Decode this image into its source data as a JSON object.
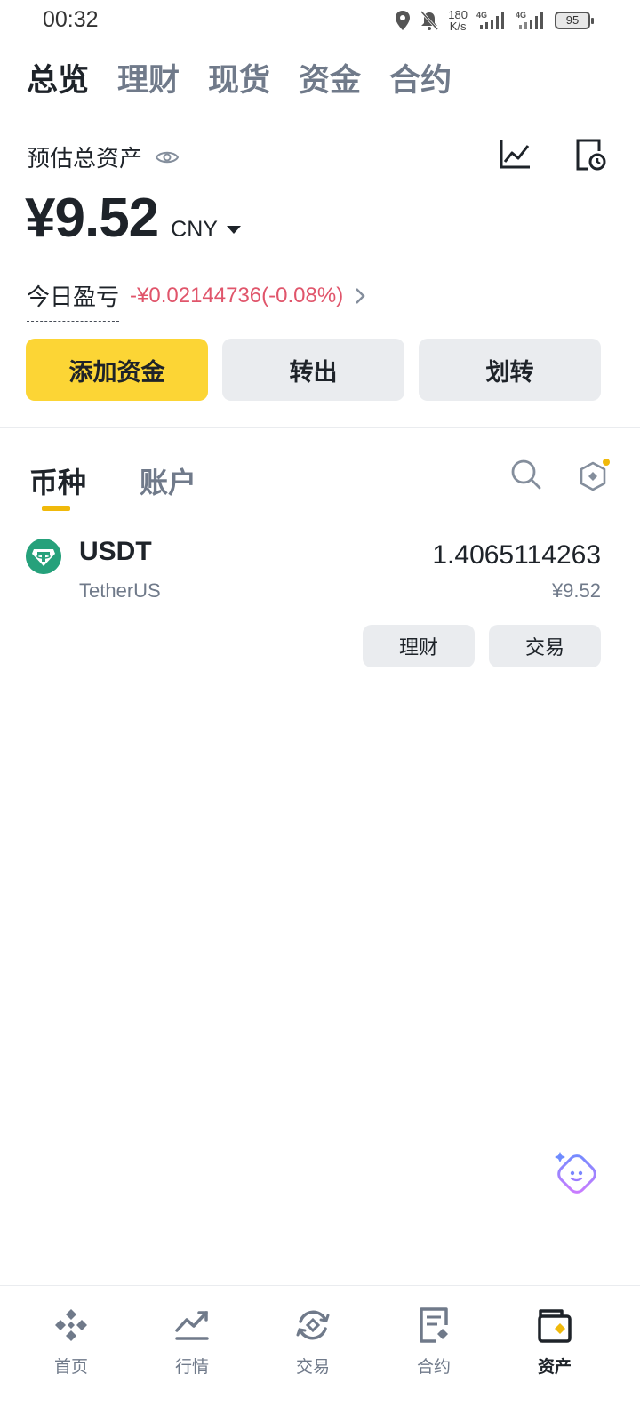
{
  "status_bar": {
    "time": "00:32",
    "speed_value": "180",
    "speed_unit": "K/s",
    "network_1": "4G",
    "network_2": "4G",
    "battery": "95"
  },
  "top_tabs": [
    {
      "label": "总览",
      "active": true
    },
    {
      "label": "理财",
      "active": false
    },
    {
      "label": "现货",
      "active": false
    },
    {
      "label": "资金",
      "active": false
    },
    {
      "label": "合约",
      "active": false
    }
  ],
  "overview": {
    "estimated_label": "预估总资产",
    "balance": "¥9.52",
    "currency": "CNY",
    "pnl_label": "今日盈亏",
    "pnl_value": "-¥0.02144736(-0.08%)"
  },
  "actions": {
    "deposit": "添加资金",
    "withdraw": "转出",
    "transfer": "划转"
  },
  "asset_tabs": [
    {
      "label": "币种",
      "active": true
    },
    {
      "label": "账户",
      "active": false
    }
  ],
  "assets": [
    {
      "symbol": "USDT",
      "name": "TetherUS",
      "amount": "1.4065114263",
      "value": "¥9.52",
      "buttons": {
        "earn": "理财",
        "trade": "交易"
      }
    }
  ],
  "bottom_nav": [
    {
      "label": "首页",
      "icon": "home-icon",
      "active": false
    },
    {
      "label": "行情",
      "icon": "markets-icon",
      "active": false
    },
    {
      "label": "交易",
      "icon": "trade-icon",
      "active": false
    },
    {
      "label": "合约",
      "icon": "futures-icon",
      "active": false
    },
    {
      "label": "资产",
      "icon": "wallet-icon",
      "active": true
    }
  ],
  "colors": {
    "brand_yellow": "#fcd535",
    "loss_red": "#e0556b",
    "text_primary": "#1e2329",
    "text_secondary": "#707a8a",
    "button_gray": "#eaecef",
    "usdt_green": "#26a17b"
  }
}
